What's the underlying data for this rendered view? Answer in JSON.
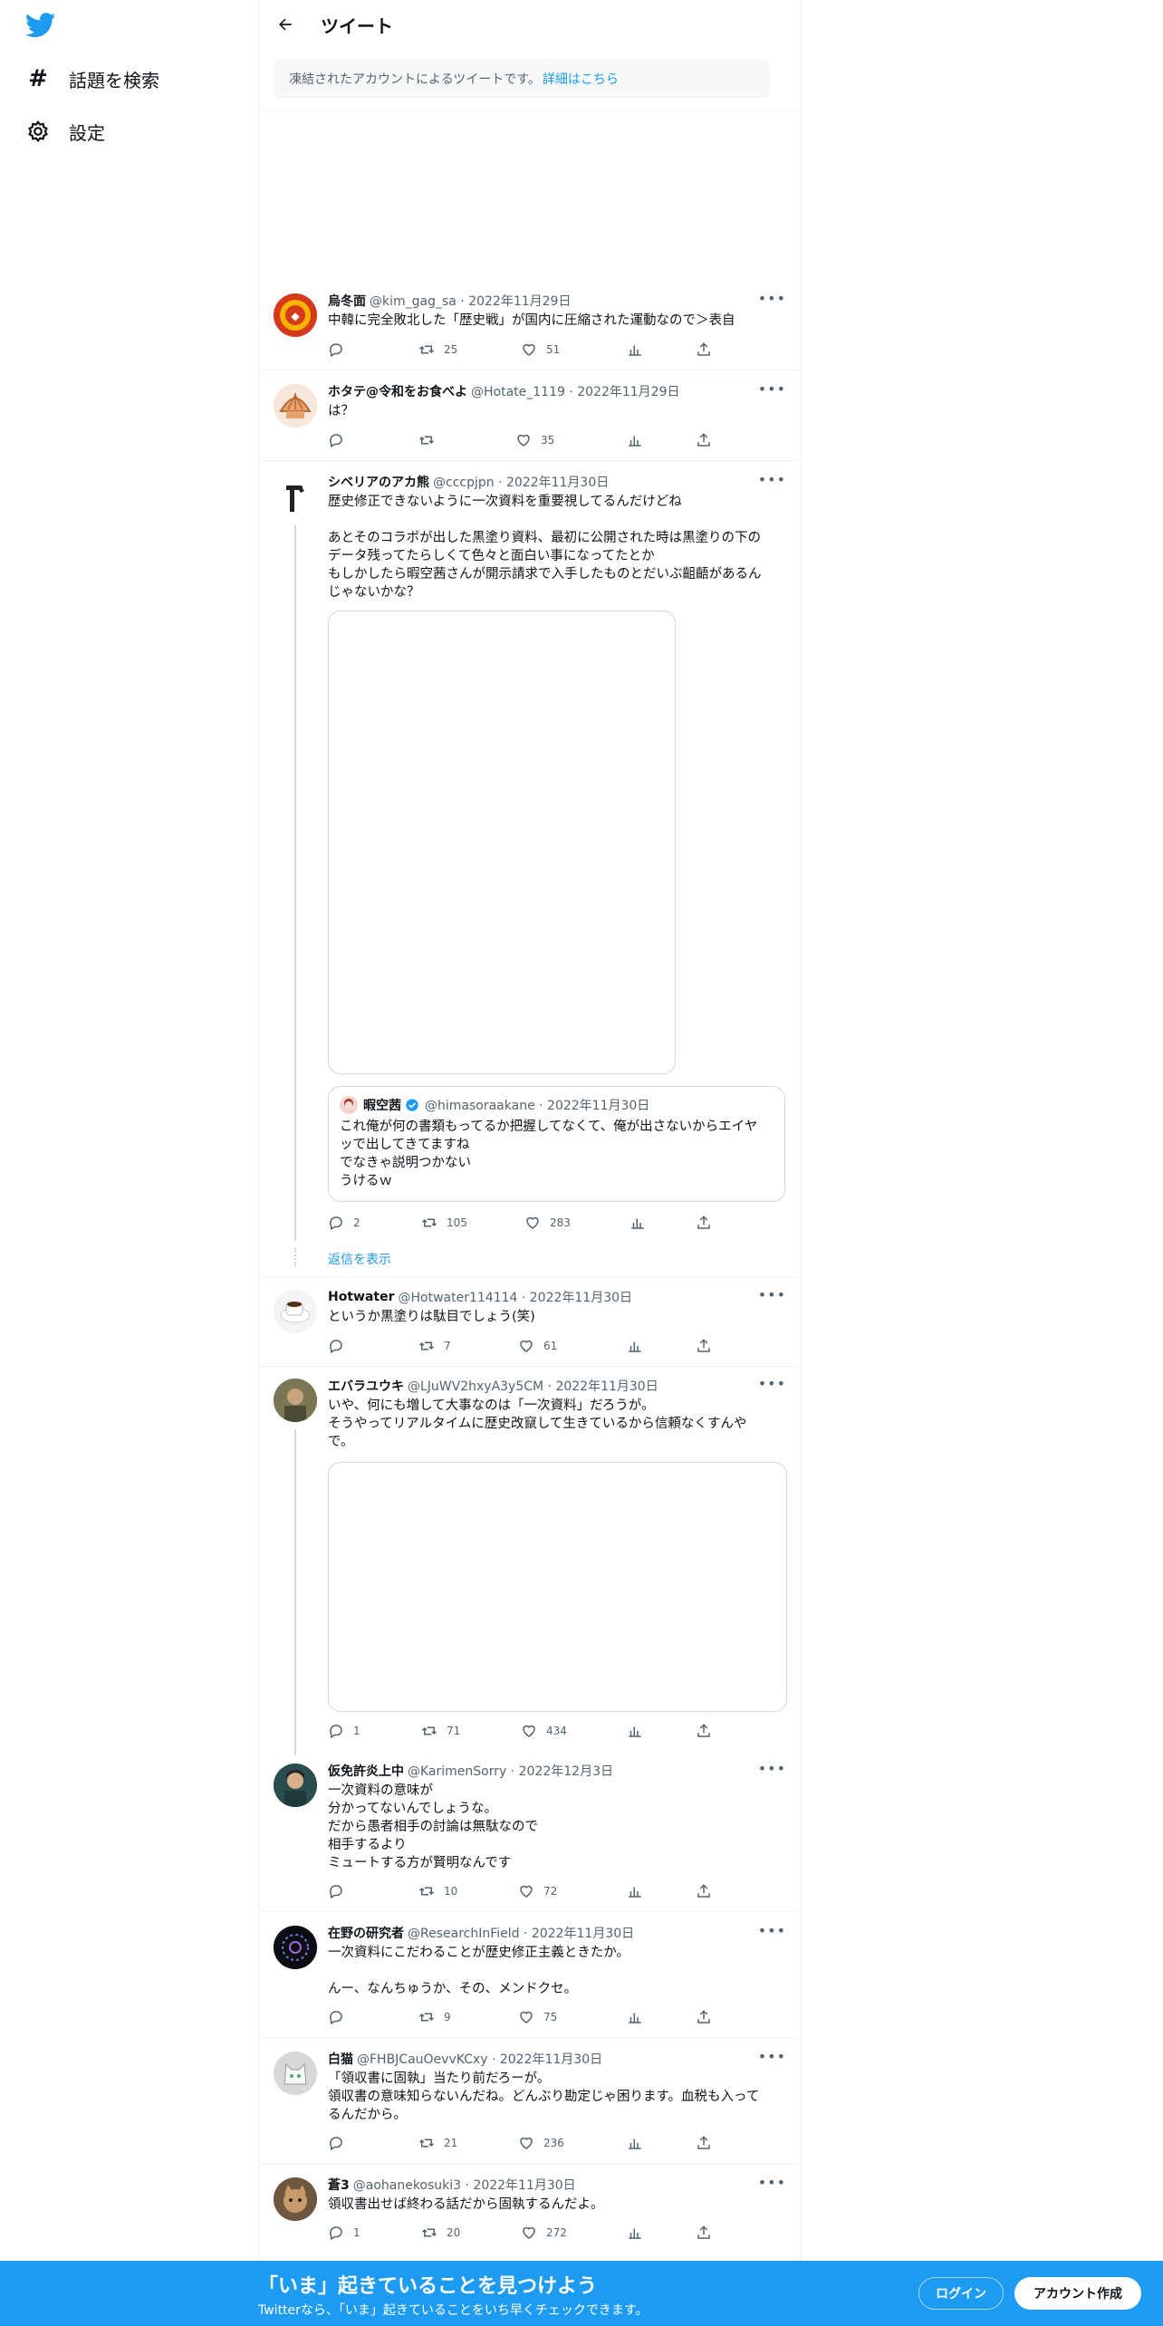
{
  "sidebar": {
    "items": [
      {
        "label": "話題を検索",
        "icon": "hashtag-icon"
      },
      {
        "label": "設定",
        "icon": "gear-icon"
      }
    ]
  },
  "header": {
    "title": "ツイート"
  },
  "notice": {
    "text": "凍結されたアカウントによるツイートです。",
    "link": "詳細はこちら"
  },
  "tweets": [
    {
      "name": "烏冬面",
      "meta": "@kim_gag_sa · 2022年11月29日",
      "body": "中韓に完全敗北した「歴史戦」が国内に圧縮された運動なので＞表自",
      "reply": "",
      "retweet": "25",
      "like": "51"
    },
    {
      "name": "ホタテ@令和をお食べよ",
      "meta": "@Hotate_1119 · 2022年11月29日",
      "body": "は？",
      "reply": "",
      "retweet": "",
      "like": "35"
    },
    {
      "name": "シベリアのアカ熊",
      "meta": "@cccpjpn · 2022年11月30日",
      "body": "歴史修正できないように一次資料を重要視してるんだけどね\n\nあとそのコラボが出した黒塗り資料、最初に公開された時は黒塗りの下の\nデータ残ってたらしくて色々と面白い事になってたとか\nもしかしたら暇空茜さんが開示請求で入手したものとだいぶ齟齬があるん\nじゃないかな？",
      "reply": "2",
      "retweet": "105",
      "like": "283"
    },
    {
      "name": "Hotwater",
      "meta": "@Hotwater114114 · 2022年11月30日",
      "body": "というか黒塗りは駄目でしょう(笑)",
      "reply": "",
      "retweet": "7",
      "like": "61"
    },
    {
      "name": "エバラユウキ",
      "meta": "@LJuWV2hxyA3y5CM · 2022年11月30日",
      "body": "いや、何にも増して大事なのは「一次資料」だろうが。\nそうやってリアルタイムに歴史改竄して生きているから信頼なくすんや\nで。",
      "reply": "1",
      "retweet": "71",
      "like": "434"
    },
    {
      "name": "仮免許炎上中",
      "meta": "@KarimenSorry · 2022年12月3日",
      "body": "一次資料の意味が\n分かってないんでしょうな。\nだから愚者相手の討論は無駄なので\n相手するより\nミュートする方が賢明なんです",
      "reply": "",
      "retweet": "10",
      "like": "72"
    },
    {
      "name": "在野の研究者",
      "meta": "@ResearchInField · 2022年11月30日",
      "body": "一次資料にこだわることが歴史修正主義ときたか。\n\nんー、なんちゅうか、その、メンドクセ。",
      "reply": "",
      "retweet": "9",
      "like": "75"
    },
    {
      "name": "白猫",
      "meta": "@FHBJCauOevvKCxy · 2022年11月30日",
      "body": "「領収書に固執」当たり前だろーが。\n領収書の意味知らないんだね。どんぶり勘定じゃ困ります。血税も入って\nるんだから。",
      "reply": "",
      "retweet": "21",
      "like": "236"
    },
    {
      "name": "蒼3",
      "meta": "@aohanekosuki3 · 2022年11月30日",
      "body": "領収書出せば終わる話だから固執するんだよ。",
      "reply": "1",
      "retweet": "20",
      "like": "272"
    }
  ],
  "quote": {
    "name": "暇空茜",
    "meta": "@himasoraakane · 2022年11月30日",
    "body": "これ俺が何の書類もってるか把握してなくて、俺が出さないからエイヤ\nッで出してきてますね\nでなきゃ説明つかない\nうけるｗ"
  },
  "show_replies": "返信を表示",
  "banner": {
    "headline": "「いま」起きていることを見つけよう",
    "sub": "Twitterなら、「いま」起きていることをいち早くチェックできます。",
    "login": "ログイン",
    "signup": "アカウント作成"
  },
  "colors": {
    "accent": "#1d9bf0",
    "text": "#0f1419",
    "muted": "#536471",
    "border": "#eff3f4"
  }
}
